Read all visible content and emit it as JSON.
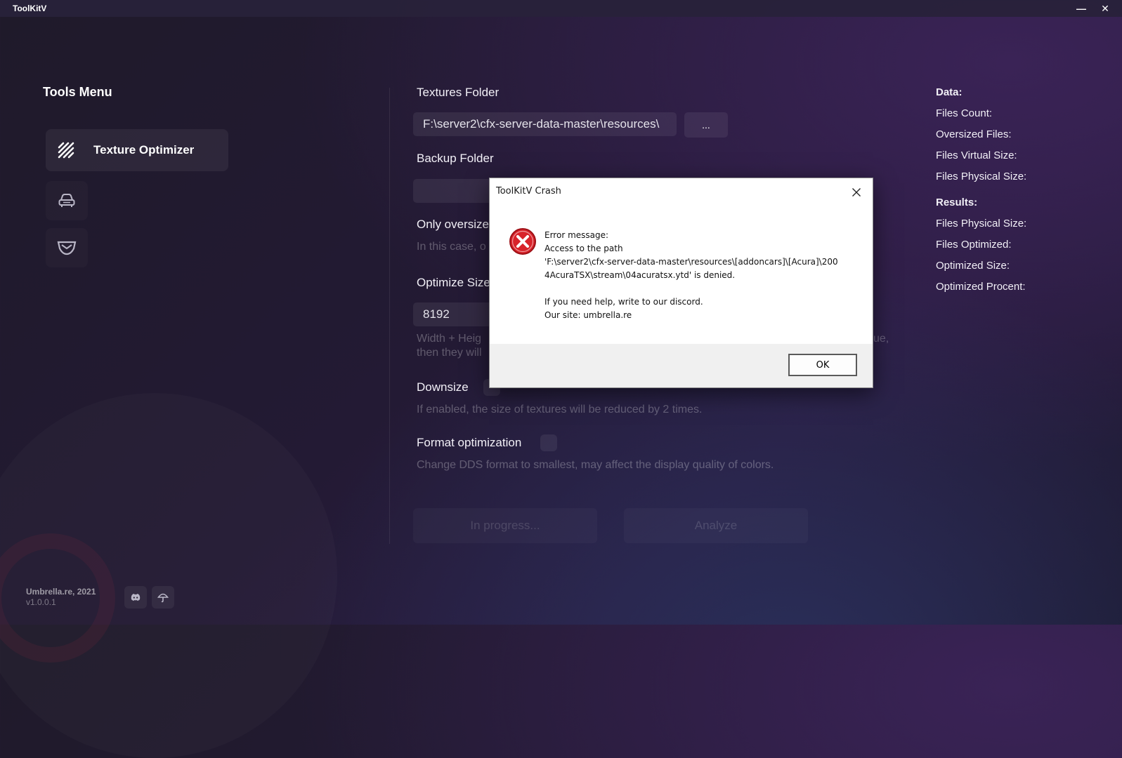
{
  "window": {
    "title": "ToolKitV",
    "minimize": "—",
    "close": "✕"
  },
  "sidebar": {
    "title": "Tools Menu",
    "items": [
      {
        "label": "Texture Optimizer",
        "icon": "texture-stripes-icon",
        "active": true
      },
      {
        "label": "",
        "icon": "car-icon",
        "active": false
      },
      {
        "label": "",
        "icon": "shield-badge-icon",
        "active": false
      }
    ]
  },
  "main": {
    "textures_folder": {
      "label": "Textures Folder",
      "value": "F:\\server2\\cfx-server-data-master\\resources\\",
      "browse": "..."
    },
    "backup_folder": {
      "label": "Backup Folder",
      "value": ""
    },
    "only_oversized": {
      "label": "Only oversize",
      "desc": "In this case, o"
    },
    "optimize_size": {
      "label": "Optimize Size",
      "value": "8192",
      "desc_line1": "Width + Heig",
      "desc_line1_tail": "ue,",
      "desc_line2": "then they will"
    },
    "downsize": {
      "label": "Downsize",
      "desc": "If enabled, the size of textures will be reduced by 2 times."
    },
    "format_optimization": {
      "label": "Format optimization",
      "desc": "Change DDS format to smallest, may affect the display quality of colors."
    },
    "buttons": {
      "progress": "In progress...",
      "analyze": "Analyze"
    }
  },
  "stats": {
    "data_header": "Data:",
    "data": [
      "Files Count:",
      "Oversized Files:",
      "Files Virtual Size:",
      "Files Physical Size:"
    ],
    "results_header": "Results:",
    "results": [
      "Files Physical Size:",
      "Files Optimized:",
      "Optimized Size:",
      "Optimized Procent:"
    ]
  },
  "footer": {
    "brand": "Umbrella.re, 2021",
    "version": "v1.0.0.1"
  },
  "dialog": {
    "title": "ToolKitV Crash",
    "lines": [
      "Error message:",
      "Access to the path",
      "'F:\\server2\\cfx-server-data-master\\resources\\[addoncars]\\[Acura]\\200",
      "4AcuraTSX\\stream\\04acuratsx.ytd' is denied.",
      "",
      "If you need help, write to our discord.",
      "Our site: umbrella.re"
    ],
    "ok": "OK"
  },
  "colors": {
    "error_red": "#d8232a",
    "panel_bg": "#231a34"
  }
}
